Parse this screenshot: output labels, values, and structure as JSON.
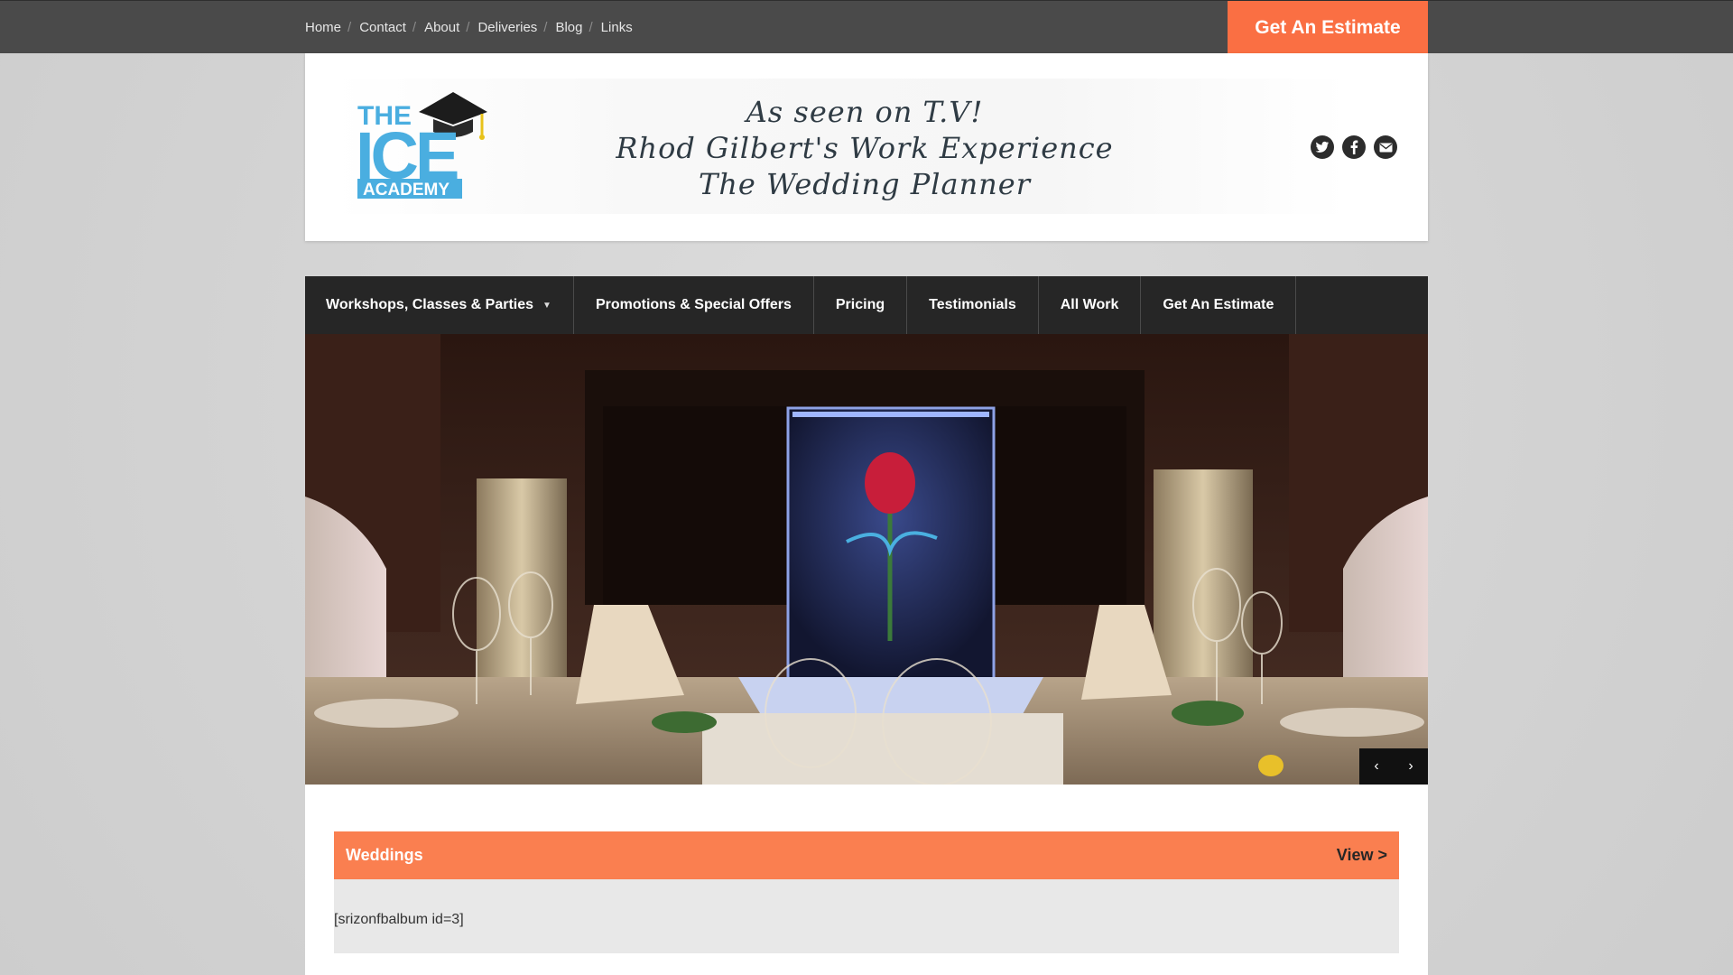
{
  "topbar": {
    "breadcrumb": [
      "Home",
      "Contact",
      "About",
      "Deliveries",
      "Blog",
      "Links"
    ],
    "separator": "/",
    "estimate_label": "Get An Estimate"
  },
  "header": {
    "logo": {
      "line1": "THE",
      "line2": "ICE",
      "line3": "ACADEMY",
      "icon": "graduation-cap-icon"
    },
    "tagline": [
      "As seen on T.V!",
      "Rhod Gilbert's Work Experience",
      "The Wedding Planner"
    ],
    "social_icons": [
      "twitter-icon",
      "facebook-icon",
      "email-icon"
    ]
  },
  "mainnav": {
    "items": [
      {
        "label": "Workshops, Classes & Parties",
        "has_dropdown": true
      },
      {
        "label": "Promotions & Special Offers"
      },
      {
        "label": "Pricing"
      },
      {
        "label": "Testimonials"
      },
      {
        "label": "All Work"
      },
      {
        "label": "Get An Estimate"
      }
    ]
  },
  "slider": {
    "image": "ice-sculpture-rose-wedding-table",
    "prev_label": "‹",
    "next_label": "›"
  },
  "album": {
    "title": "Weddings",
    "view_label": "View >",
    "body": "[srizonfbalbum id=3]"
  },
  "colors": {
    "accent": "#fa6f43",
    "album_bar": "#fa7f50",
    "nav_bg": "#262626",
    "topbar_bg": "#4a4a4a"
  }
}
